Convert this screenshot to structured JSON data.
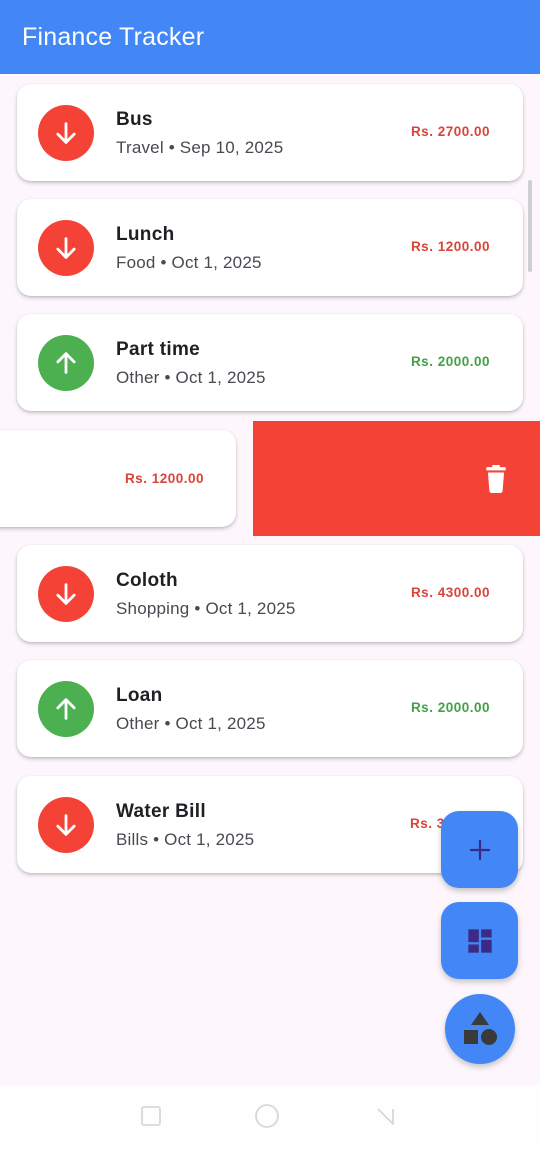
{
  "appbar": {
    "title": "Finance Tracker",
    "color": "#4287f5"
  },
  "colors": {
    "expense": "#f44336",
    "income": "#4caf50",
    "expense_amount": "#d9443a",
    "income_amount": "#43a047"
  },
  "transactions": [
    {
      "title": "Bus",
      "subtitle": "Travel • Sep 10, 2025",
      "amount": "Rs. 2700.00",
      "type": "expense",
      "icon": "arrow-down-icon"
    },
    {
      "title": "Lunch",
      "subtitle": "Food • Oct 1, 2025",
      "amount": "Rs. 1200.00",
      "type": "expense",
      "icon": "arrow-down-icon"
    },
    {
      "title": "Part time",
      "subtitle": "Other • Oct 1, 2025",
      "amount": "Rs. 2000.00",
      "type": "income",
      "icon": "arrow-up-icon"
    },
    {
      "title": "Coloth",
      "subtitle": "Shopping • Oct 1, 2025",
      "amount": "Rs. 4300.00",
      "type": "expense",
      "icon": "arrow-down-icon"
    },
    {
      "title": "Loan",
      "subtitle": "Other • Oct 1, 2025",
      "amount": "Rs. 2000.00",
      "type": "income",
      "icon": "arrow-up-icon"
    },
    {
      "title": "Water Bill",
      "subtitle": "Bills • Oct 1, 2025",
      "amount": "Rs. 3",
      "type": "expense",
      "icon": "arrow-down-icon"
    }
  ],
  "swiped_item": {
    "amount": "Rs. 1200.00",
    "type": "expense",
    "action_icon": "trash-icon"
  },
  "fabs": [
    {
      "name": "add",
      "icon": "plus-icon"
    },
    {
      "name": "dashboard",
      "icon": "dashboard-icon"
    },
    {
      "name": "categories",
      "icon": "shapes-icon"
    }
  ]
}
